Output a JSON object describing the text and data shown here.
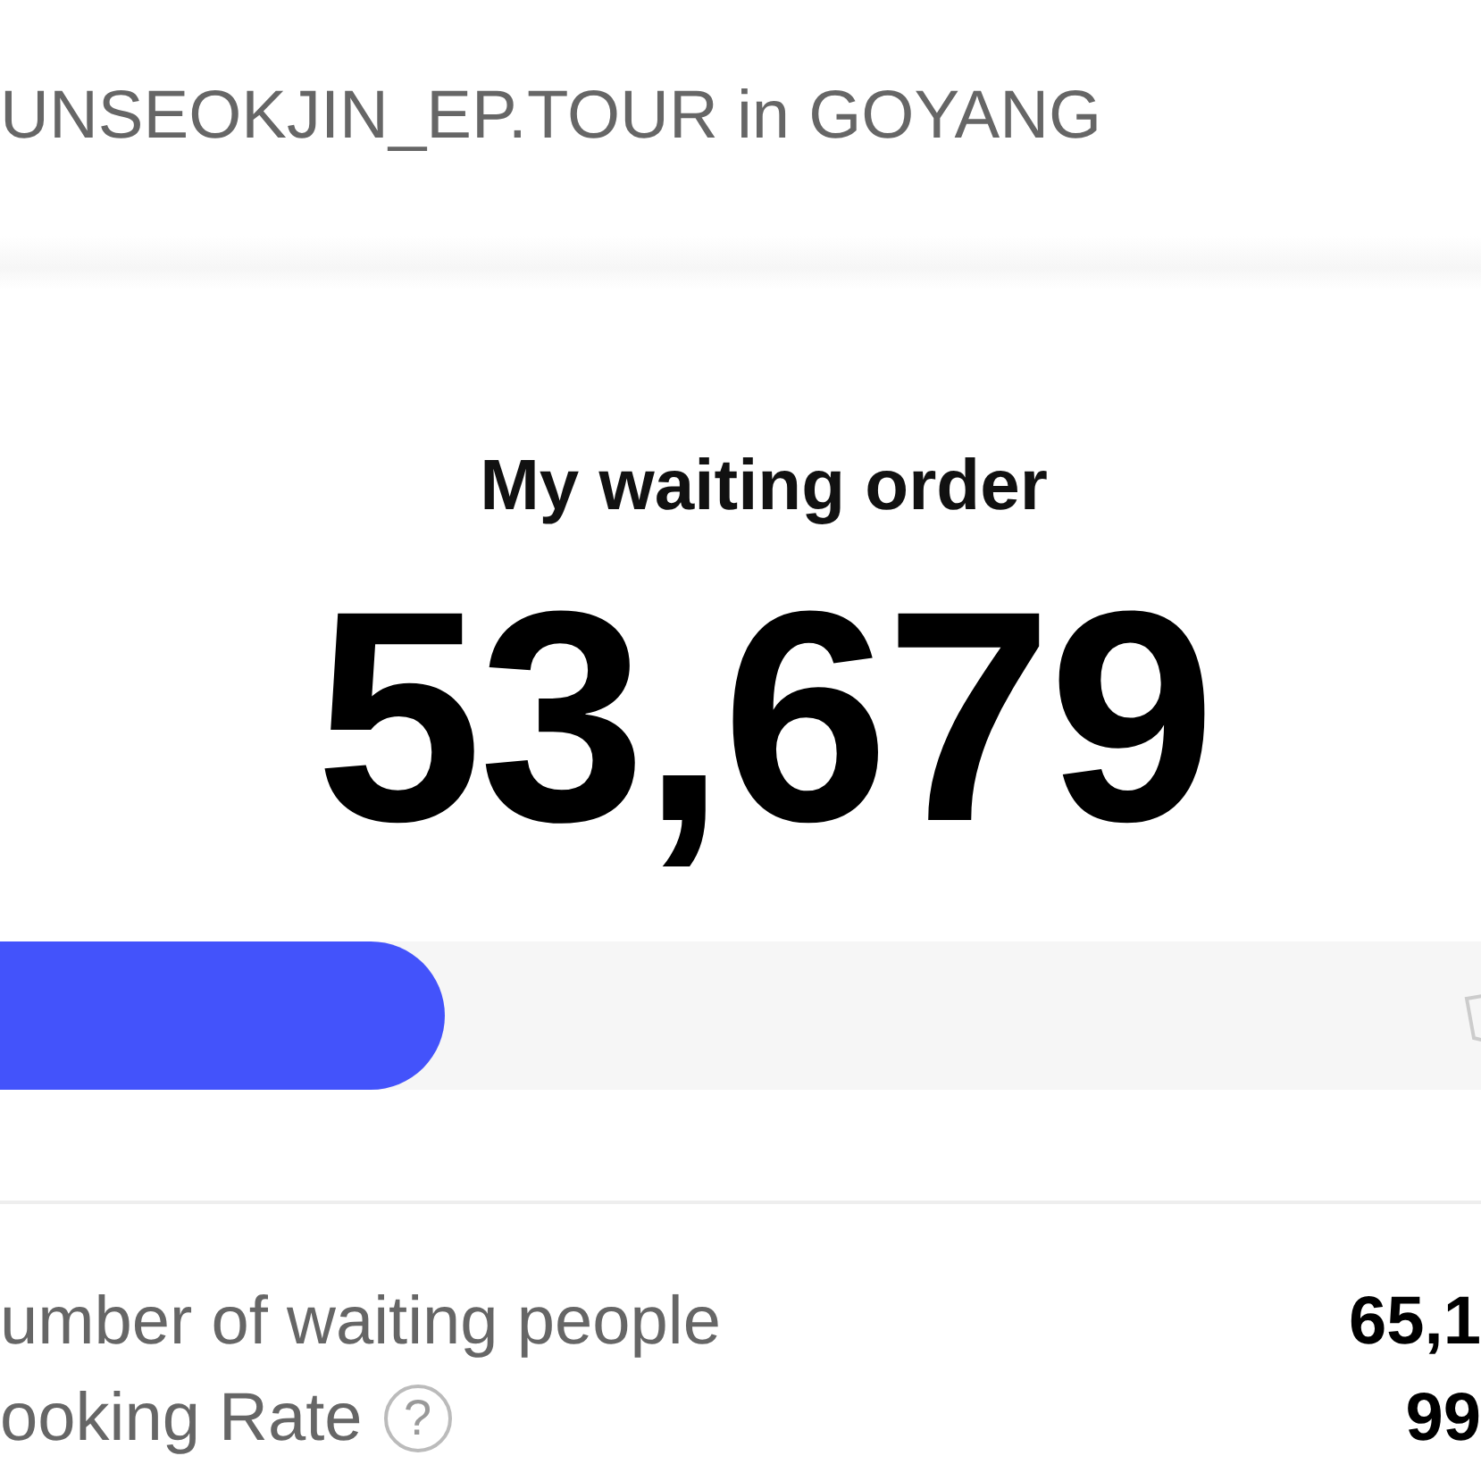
{
  "header": {
    "title": "UNSEOKJIN_EP.TOUR in GOYANG"
  },
  "queue": {
    "label": "My waiting order",
    "order": "53,679",
    "progress": {
      "level": 0.3
    }
  },
  "stats": [
    {
      "label": "umber of waiting people",
      "value": "65,1"
    },
    {
      "label": "ooking Rate",
      "value": "99",
      "help_icon": "?"
    }
  ]
}
